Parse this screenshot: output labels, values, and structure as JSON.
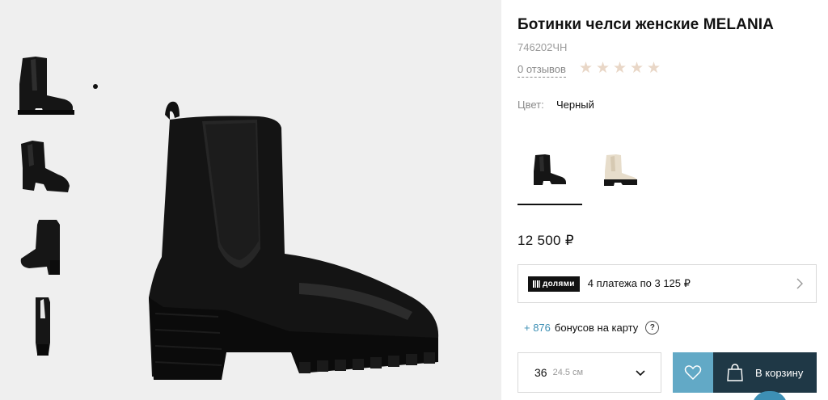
{
  "product": {
    "title": "Ботинки челси женские MELANIA",
    "sku": "746202ЧН",
    "reviews_label": "0 отзывов",
    "rating_stars": 5,
    "color_label": "Цвет:",
    "color_value": "Черный",
    "price": "12 500 ₽"
  },
  "dolyami": {
    "badge_label": "долями",
    "text": "4 платежа по 3 125 ₽"
  },
  "bonus": {
    "value": "+ 876",
    "text": "бонусов на карту",
    "help_label": "?"
  },
  "size_select": {
    "size": "36",
    "size_cm": "24.5 см"
  },
  "cart": {
    "label": "В корзину"
  },
  "colors": {
    "accent_blue": "#62a9c6",
    "cart_dark": "#1f3846",
    "bonus_blue": "#3d8fb4",
    "star_empty": "#e9d7c7",
    "gallery_bg": "#efefef"
  },
  "swatches": [
    "black",
    "beige"
  ],
  "icons": [
    "star-icon",
    "chevron-right-icon",
    "help-icon",
    "chevron-down-icon",
    "heart-icon",
    "shopping-bag-icon"
  ]
}
